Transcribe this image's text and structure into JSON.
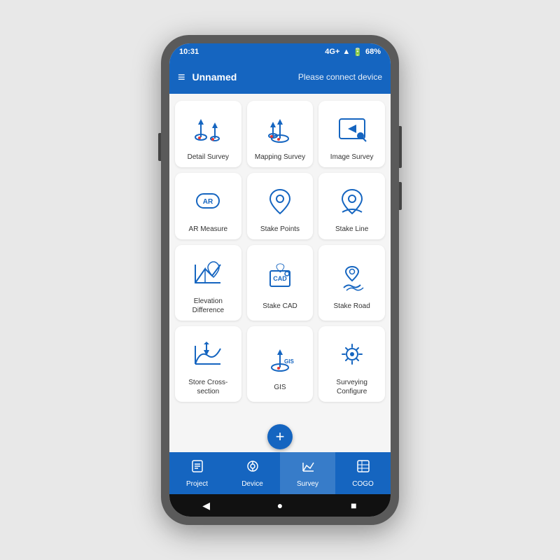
{
  "statusBar": {
    "time": "10:31",
    "signal": "4G+",
    "battery": "68%"
  },
  "appBar": {
    "menu_icon": "≡",
    "title": "Unnamed",
    "connect_text": "Please connect device"
  },
  "grid": {
    "items": [
      {
        "id": "detail-survey",
        "label": "Detail Survey",
        "icon": "detail"
      },
      {
        "id": "mapping-survey",
        "label": "Mapping Survey",
        "icon": "mapping"
      },
      {
        "id": "image-survey",
        "label": "Image Survey",
        "icon": "image"
      },
      {
        "id": "ar-measure",
        "label": "AR Measure",
        "icon": "ar"
      },
      {
        "id": "stake-points",
        "label": "Stake Points",
        "icon": "stake-points"
      },
      {
        "id": "stake-line",
        "label": "Stake Line",
        "icon": "stake-line"
      },
      {
        "id": "elevation-difference",
        "label": "Elevation Difference",
        "icon": "elevation"
      },
      {
        "id": "stake-cad",
        "label": "Stake CAD",
        "icon": "cad"
      },
      {
        "id": "stake-road",
        "label": "Stake Road",
        "icon": "road"
      },
      {
        "id": "store-cross-section",
        "label": "Store Cross-section",
        "icon": "cross"
      },
      {
        "id": "gis",
        "label": "GIS",
        "icon": "gis"
      },
      {
        "id": "surveying-configure",
        "label": "Surveying Configure",
        "icon": "configure"
      }
    ]
  },
  "bottomNav": {
    "items": [
      {
        "id": "project",
        "label": "Project",
        "icon": "doc"
      },
      {
        "id": "device",
        "label": "Device",
        "icon": "device"
      },
      {
        "id": "survey",
        "label": "Survey",
        "icon": "survey",
        "active": true
      },
      {
        "id": "cogo",
        "label": "COGO",
        "icon": "calc"
      }
    ]
  },
  "systemNav": {
    "back": "◀",
    "home": "●",
    "recent": "■"
  },
  "fab": {
    "icon": "+"
  }
}
